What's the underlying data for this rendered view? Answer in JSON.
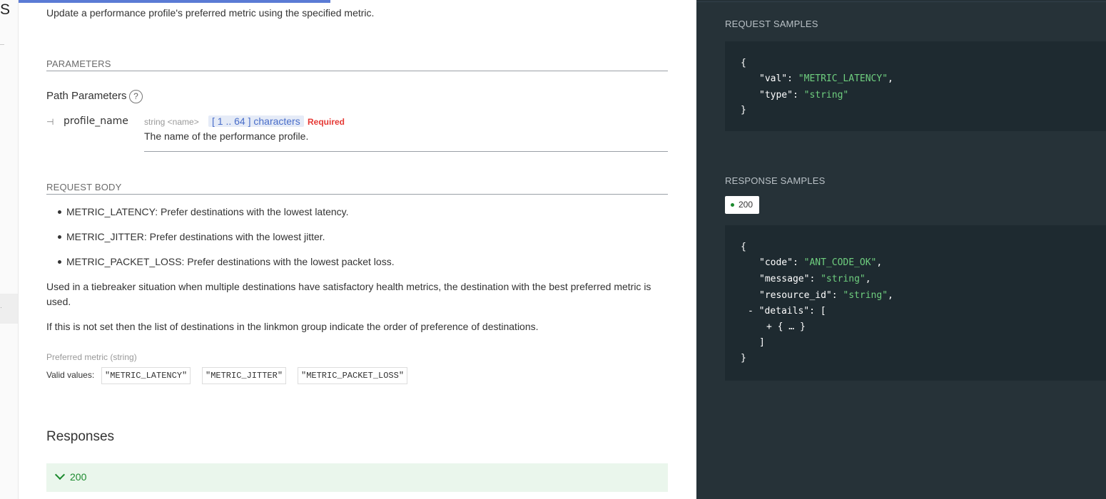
{
  "sidebar": {
    "menu_letter": "S",
    "highlight_glyph": "·"
  },
  "description": "Update a performance profile's preferred metric using the specified metric.",
  "parameters": {
    "heading": "PARAMETERS",
    "path_title": "Path Parameters",
    "help_glyph": "?",
    "param": {
      "branch_glyph": "⊣",
      "name": "profile_name",
      "type": "string <name>",
      "range": "[ 1 .. 64 ] characters",
      "required": "Required",
      "description": "The name of the performance profile."
    }
  },
  "request_body": {
    "heading": "REQUEST BODY",
    "bullets": [
      "METRIC_LATENCY: Prefer destinations with the lowest latency.",
      "METRIC_JITTER: Prefer destinations with the lowest jitter.",
      "METRIC_PACKET_LOSS: Prefer destinations with the lowest packet loss."
    ],
    "para1": "Used in a tiebreaker situation when multiple destinations have satisfactory health metrics, the destination with the best preferred metric is used.",
    "para2": "If this is not set then the list of destinations in the linkmon group indicate the order of preference of destinations.",
    "pref_label": "Preferred metric (string)",
    "valid_label": "Valid values:",
    "valid_values": [
      "\"METRIC_LATENCY\"",
      "\"METRIC_JITTER\"",
      "\"METRIC_PACKET_LOSS\""
    ]
  },
  "responses": {
    "title": "Responses",
    "code": "200"
  },
  "right_panel": {
    "request_heading": "REQUEST SAMPLES",
    "request_lines": [
      {
        "text": "{"
      },
      {
        "key": "\"val\"",
        "sep": ": ",
        "val": "\"METRIC_LATENCY\"",
        "tail": ","
      },
      {
        "key": "\"type\"",
        "sep": ": ",
        "val": "\"string\"",
        "tail": ""
      },
      {
        "text": "}"
      }
    ],
    "response_heading": "RESPONSE SAMPLES",
    "status_code": "200",
    "response_lines": [
      {
        "text": "{"
      },
      {
        "key": "\"code\"",
        "sep": ": ",
        "val": "\"ANT_CODE_OK\"",
        "tail": ","
      },
      {
        "key": "\"message\"",
        "sep": ": ",
        "val": "\"string\"",
        "tail": ","
      },
      {
        "key": "\"resource_id\"",
        "sep": ": ",
        "val": "\"string\"",
        "tail": ","
      },
      {
        "text": "- \"details\": ["
      },
      {
        "text": "+ { … }"
      },
      {
        "text": "]"
      },
      {
        "text": "}"
      }
    ]
  }
}
